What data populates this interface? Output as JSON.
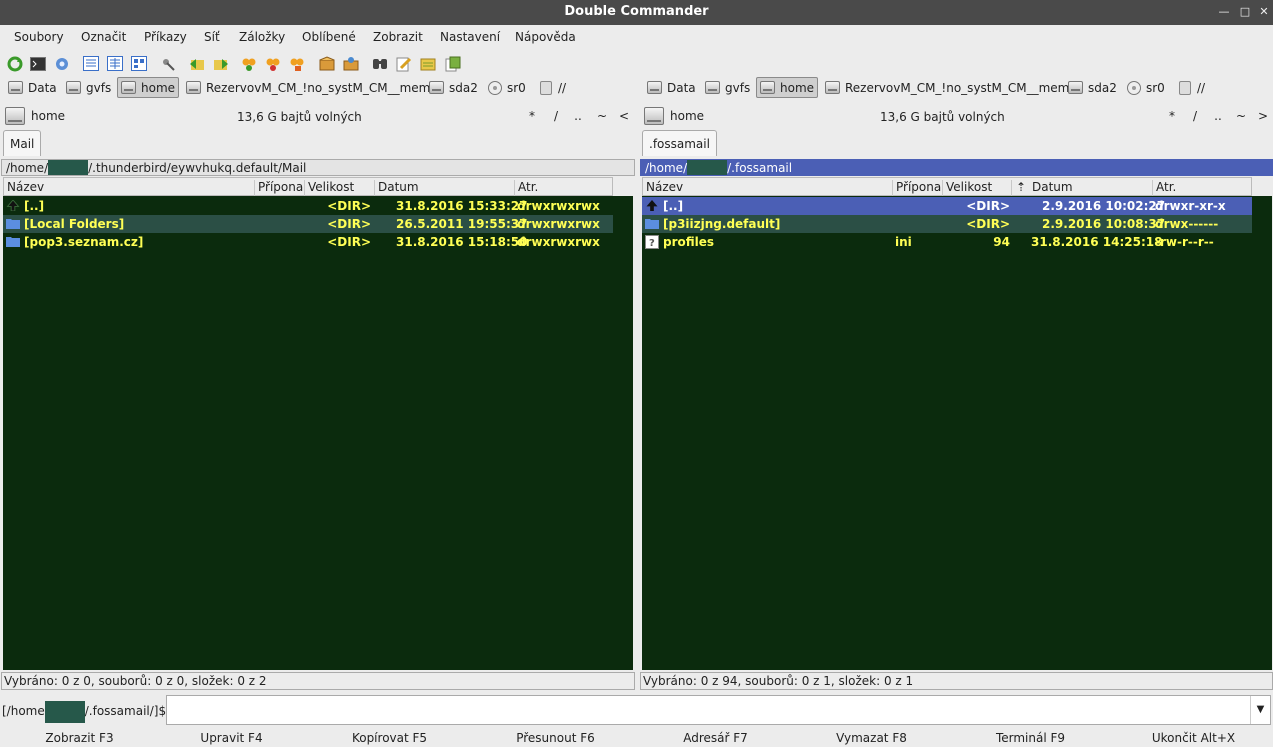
{
  "window": {
    "title": "Double Commander",
    "controls": [
      "—",
      "□",
      "✕"
    ]
  },
  "menu": [
    "Soubory",
    "Označit",
    "Příkazy",
    "Síť",
    "Záložky",
    "Oblíbené",
    "Zobrazit",
    "Nastavení",
    "Nápověda"
  ],
  "toolbar": [
    "refresh-icon",
    "terminal-icon",
    "settings-icon",
    "brief-view-icon",
    "full-view-icon",
    "thumbnails-view-icon",
    "back-icon",
    "forward-icon",
    "compare-icon",
    "sync-icon",
    "multirename-icon",
    "pack-icon",
    "unpack-icon",
    "search-icon",
    "edit-icon",
    "directory-hotlist-icon",
    "copy-name-icon"
  ],
  "drives": {
    "d1": "Data",
    "d2": "gvfs",
    "d3": "home",
    "d4": "RezervovM_CM_!no_systM_CM__mem",
    "d5": "sda2",
    "d6": "sr0",
    "d7": "//"
  },
  "left": {
    "drive": "home",
    "free": "13,6 G bajtů volných",
    "nav": [
      "*",
      "/",
      "..",
      "~",
      "<"
    ],
    "tab": "Mail",
    "path_a": "/home/",
    "path_b": "/.thunderbird/eywvhukq.default/Mail",
    "cols": {
      "name": "Název",
      "ext": "Přípona",
      "size": "Velikost",
      "date": "Datum",
      "attr": "Atr."
    },
    "rows": [
      {
        "name": "[..]",
        "ext": "",
        "size": "<DIR>",
        "date": "31.8.2016 15:33:27",
        "attr": "drwxrwxrwx"
      },
      {
        "name": "[Local Folders]",
        "ext": "",
        "size": "<DIR>",
        "date": "26.5.2011 19:55:37",
        "attr": "drwxrwxrwx"
      },
      {
        "name": "[pop3.seznam.cz]",
        "ext": "",
        "size": "<DIR>",
        "date": "31.8.2016 15:18:50",
        "attr": "drwxrwxrwx"
      }
    ],
    "status": "Vybráno: 0 z 0, souborů: 0 z 0, složek: 0 z 2"
  },
  "right": {
    "drive": "home",
    "free": "13,6 G bajtů volných",
    "nav": [
      "*",
      "/",
      "..",
      "~",
      ">"
    ],
    "tab": ".fossamail",
    "path_a": "/home/",
    "path_b": "/.fossamail",
    "cols": {
      "name": "Název",
      "ext": "Přípona",
      "size": "Velikost",
      "date": "Datum",
      "attr": "Atr."
    },
    "rows": [
      {
        "name": "[..]",
        "ext": "",
        "size": "<DIR>",
        "date": "2.9.2016 10:02:27",
        "attr": "drwxr-xr-x"
      },
      {
        "name": "[p3iizjng.default]",
        "ext": "",
        "size": "<DIR>",
        "date": "2.9.2016 10:08:37",
        "attr": "drwx------"
      },
      {
        "name": "profiles",
        "ext": "ini",
        "size": "94",
        "date": "31.8.2016 14:25:18",
        "attr": "-rw-r--r--"
      }
    ],
    "status": "Vybráno: 0 z 94, souborů: 0 z 1, složek: 0 z 1"
  },
  "cmd": {
    "prompt_a": "[/home",
    "prompt_b": "/.fossamail/]$:",
    "value": ""
  },
  "fkeys": [
    "Zobrazit F3",
    "Upravit F4",
    "Kopírovat F5",
    "Přesunout F6",
    "Adresář F7",
    "Vymazat F8",
    "Terminál F9",
    "Ukončit Alt+X"
  ],
  "colors": {
    "list_bg": "#0b2b0d",
    "file_text": "#ffff55",
    "cursor": "#4b5fb5",
    "selected": "#2b4f45"
  }
}
